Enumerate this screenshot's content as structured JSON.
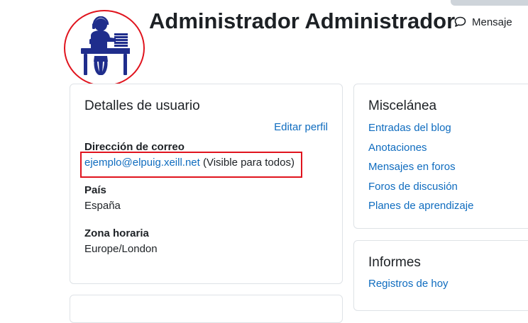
{
  "header": {
    "title": "Administrador Administrador",
    "message_label": "Mensaje"
  },
  "user_details": {
    "title": "Detalles de usuario",
    "edit_profile_label": "Editar perfil",
    "email_label": "Dirección de correo",
    "email_value": "ejemplo@elpuig.xeill.net",
    "email_visibility": " (Visible para todos)",
    "country_label": "País",
    "country_value": "España",
    "timezone_label": "Zona horaria",
    "timezone_value": "Europe/London"
  },
  "misc": {
    "title": "Miscelánea",
    "links": [
      {
        "label": "Entradas del blog"
      },
      {
        "label": "Anotaciones"
      },
      {
        "label": "Mensajes en foros"
      },
      {
        "label": "Foros de discusión"
      },
      {
        "label": "Planes de aprendizaje"
      }
    ]
  },
  "reports": {
    "title": "Informes",
    "links": [
      {
        "label": "Registros de hoy"
      }
    ]
  },
  "colors": {
    "link": "#0f6cbf",
    "highlight": "#e0141e",
    "avatar": "#1f2d8c"
  },
  "icons": {
    "avatar": "person-at-desk-icon",
    "message": "speech-bubble-icon"
  }
}
